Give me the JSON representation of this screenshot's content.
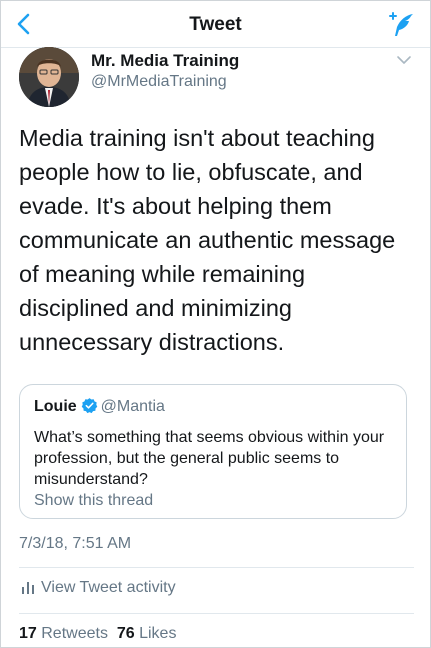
{
  "navbar": {
    "title": "Tweet",
    "back_icon": "chevron-left-icon",
    "compose_icon": "compose-tweet-icon",
    "accent": "#1da1f2"
  },
  "author": {
    "name": "Mr. Media Training",
    "handle": "@MrMediaTraining",
    "avatar_icon": "avatar-photo",
    "menu_icon": "chevron-down-icon"
  },
  "tweet": {
    "text": "Media training isn't about teaching people how to lie, obfuscate, and evade. It's about helping them communicate an authentic message of meaning while remaining disciplined and minimizing unnecessary distractions."
  },
  "quoted_tweet": {
    "name": "Louie",
    "verified_icon": "verified-badge-icon",
    "handle": "@Mantia",
    "text": "What’s something that seems obvious within your profession, but the general public seems to misunderstand?",
    "thread_link": "Show this thread"
  },
  "timestamp": "7/3/18, 7:51 AM",
  "activity": {
    "label": "View Tweet activity",
    "icon": "analytics-bars-icon"
  },
  "stats": {
    "retweets_count": "17",
    "retweets_label": "Retweets",
    "likes_count": "76",
    "likes_label": "Likes"
  },
  "colors": {
    "text": "#14171a",
    "secondary": "#657786",
    "divider": "#e1e8ed",
    "accent": "#1da1f2"
  }
}
